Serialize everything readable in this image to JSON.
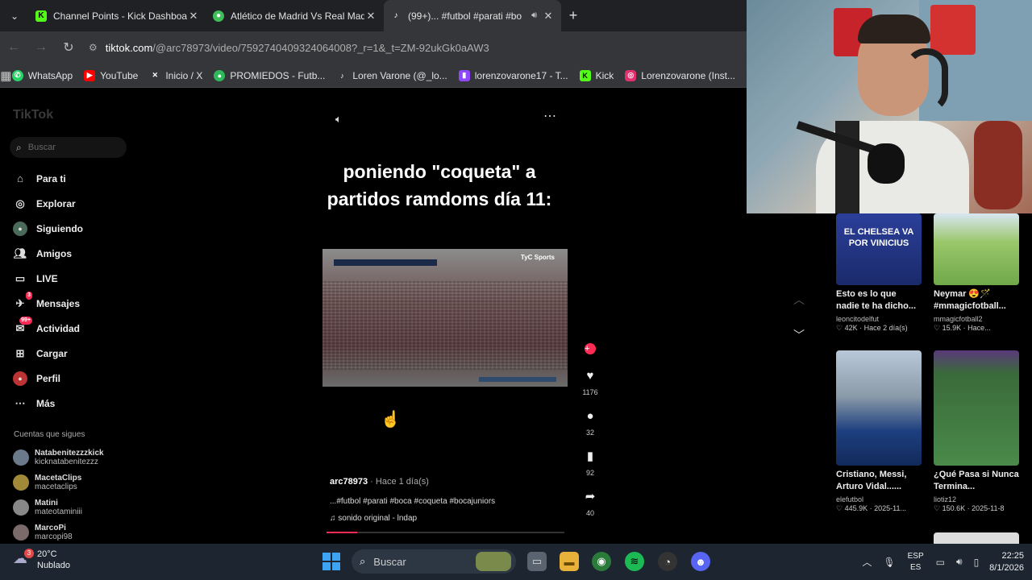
{
  "browser": {
    "tabs": [
      {
        "title": "Channel Points - Kick Dashboar",
        "icon": "kick-icon",
        "color": "#53fc18"
      },
      {
        "title": "Atlético de Madrid Vs Real Mad",
        "icon": "soccer-icon",
        "color": "#3fbf5a"
      },
      {
        "title": "(99+)... #futbol #parati #bo",
        "icon": "tiktok-icon",
        "color": "#ffffff",
        "active": true
      }
    ],
    "url_domain": "tiktok.com",
    "url_path": "/@arc78973/video/7592740409324064008?_r=1&_t=ZM-92ukGk0aAW3",
    "bookmarks": [
      {
        "label": "WhatsApp",
        "icon": "whatsapp-icon",
        "color": "#25d366"
      },
      {
        "label": "YouTube",
        "icon": "youtube-icon",
        "color": "#ff0000"
      },
      {
        "label": "Inicio / X",
        "icon": "x-icon",
        "color": "#ffffff"
      },
      {
        "label": "PROMIEDOS - Futb...",
        "icon": "promiedos-icon",
        "color": "#2eb85c"
      },
      {
        "label": "Loren Varone (@_lo...",
        "icon": "tiktok-icon",
        "color": "#ffffff"
      },
      {
        "label": "lorenzovarone17 - T...",
        "icon": "twitch-icon",
        "color": "#9146ff"
      },
      {
        "label": "Kick",
        "icon": "kick-icon",
        "color": "#53fc18"
      },
      {
        "label": "Lorenzovarone (Inst...",
        "icon": "instagram-icon",
        "color": "#e1306c"
      }
    ]
  },
  "tiktok": {
    "logo": "TikTok",
    "search_placeholder": "Buscar",
    "nav": [
      {
        "label": "Para ti",
        "icon": "home-icon"
      },
      {
        "label": "Explorar",
        "icon": "compass-icon"
      },
      {
        "label": "Siguiendo",
        "icon": "following-icon"
      },
      {
        "label": "Amigos",
        "icon": "friends-icon"
      },
      {
        "label": "LIVE",
        "icon": "live-icon"
      },
      {
        "label": "Mensajes",
        "icon": "messages-icon",
        "badge": "3"
      },
      {
        "label": "Actividad",
        "icon": "activity-icon",
        "badge": "99+"
      },
      {
        "label": "Cargar",
        "icon": "upload-icon"
      },
      {
        "label": "Perfil",
        "icon": "profile-icon"
      },
      {
        "label": "Más",
        "icon": "more-icon"
      }
    ],
    "following_title": "Cuentas que sigues",
    "following": [
      {
        "name": "Natabenitezzzkick",
        "handle": "kicknatabenitezzz"
      },
      {
        "name": "MacetaClips",
        "handle": "macetaclips"
      },
      {
        "name": "Matini",
        "handle": "mateotaminiii"
      },
      {
        "name": "MarcoPi",
        "handle": "marcopi98"
      }
    ],
    "video": {
      "caption": "poniendo \"coqueta\" a partidos ramdoms día 11:",
      "watermark": "TyC Sports",
      "author": "arc78973",
      "when": "· Hace 1 día(s)",
      "tags": "...#futbol #parati #boca #coqueta #bocajuniors",
      "sound": "♫  sonido original - lndap",
      "progress": 0.13,
      "likes": "1176",
      "comments": "32",
      "saves": "92",
      "shares": "40"
    },
    "recommended": [
      {
        "title": "Esto es lo que nadie te ha dicho...",
        "author": "leoncitodelfut",
        "meta": "♡ 42K · Hace 2 día(s)",
        "thumb_text": "EL CHELSEA VA POR VINICIUS"
      },
      {
        "title": "Neymar 😍🪄 #mmagicfotball...",
        "author": "mmagicfotball2",
        "meta": "♡ 15.9K · Hace..."
      },
      {
        "title": "Cristiano, Messi, Arturo Vidal......",
        "author": "elefutbol",
        "meta": "♡ 445.9K · 2025-11..."
      },
      {
        "title": "¿Qué Pasa si Nunca Termina...",
        "author": "liotiz12",
        "meta": "♡ 150.6K · 2025-11-8"
      }
    ]
  },
  "taskbar": {
    "temp": "20°C",
    "weather": "Nublado",
    "weather_badge": "3",
    "search": "Buscar",
    "lang1": "ESP",
    "lang2": "ES",
    "time": "22:25",
    "date": "8/1/2026"
  }
}
